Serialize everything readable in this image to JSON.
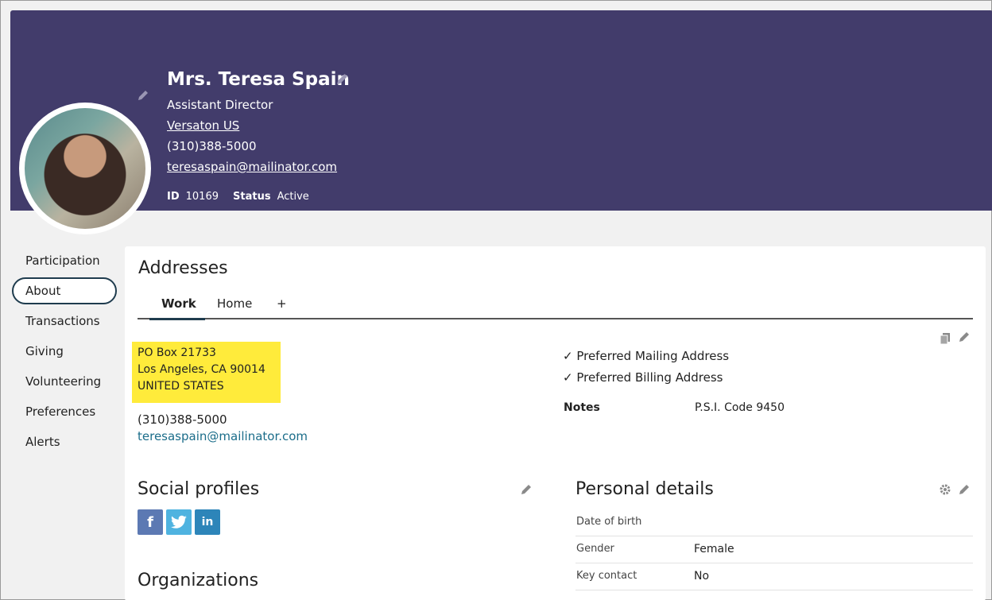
{
  "header": {
    "name": "Mrs. Teresa Spain",
    "job_title": "Assistant Director",
    "organization": "Versaton US",
    "phone": "(310)388-5000",
    "email": "teresaspain@mailinator.com",
    "id_label": "ID",
    "id_value": "10169",
    "status_label": "Status",
    "status_value": "Active",
    "banner_color": "#423c6b"
  },
  "nav": {
    "items": [
      {
        "label": "Participation"
      },
      {
        "label": "About"
      },
      {
        "label": "Transactions"
      },
      {
        "label": "Giving"
      },
      {
        "label": "Volunteering"
      },
      {
        "label": "Preferences"
      },
      {
        "label": "Alerts"
      }
    ],
    "active": "About"
  },
  "addresses": {
    "title": "Addresses",
    "tabs": [
      {
        "label": "Work"
      },
      {
        "label": "Home"
      },
      {
        "label": "+"
      }
    ],
    "active_tab": "Work",
    "lines": [
      "PO Box 21733",
      "Los Angeles, CA 90014",
      "UNITED STATES"
    ],
    "phone": "(310)388-5000",
    "email": "teresaspain@mailinator.com",
    "preferred_mailing": "✓ Preferred Mailing Address",
    "preferred_billing": "✓ Preferred Billing Address",
    "notes_label": "Notes",
    "notes_value": "P.S.I. Code 9450",
    "highlight_color": "#ffeb3b"
  },
  "social": {
    "title": "Social profiles",
    "networks": [
      "facebook-icon",
      "twitter-icon",
      "linkedin-icon"
    ]
  },
  "organizations": {
    "title": "Organizations"
  },
  "personal": {
    "title": "Personal details",
    "rows": [
      {
        "label": "Date of birth",
        "value": ""
      },
      {
        "label": "Gender",
        "value": "Female"
      },
      {
        "label": "Key contact",
        "value": "No"
      }
    ]
  }
}
